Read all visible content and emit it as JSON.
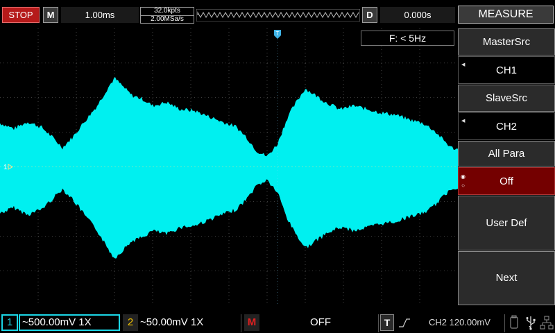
{
  "status": {
    "run_state": "STOP"
  },
  "top": {
    "horizontal_badge": "M",
    "timebase": "1.00ms",
    "memory_depth": "32.0kpts",
    "sample_rate": "2.00MSa/s",
    "delay_badge": "D",
    "delay": "0.000s"
  },
  "menu": {
    "title": "MEASURE",
    "master_src_label": "MasterSrc",
    "master_src_value": "CH1",
    "slave_src_label": "SlaveSrc",
    "slave_src_value": "CH2",
    "all_para_label": "All Para",
    "all_para_value": "Off",
    "user_def_label": "User Def",
    "next_label": "Next"
  },
  "screen": {
    "frequency_readout": "F: < 5Hz",
    "trigger_marker": "T",
    "ch1_marker": "1",
    "waveform_color": "#00f0f0",
    "grid_color": "#7a7a7a"
  },
  "bottom": {
    "ch1_badge": "1",
    "ch1_setting": "~500.00mV  1X",
    "ch2_badge": "2",
    "ch2_setting": "~50.00mV  1X",
    "math_badge": "M",
    "math_state": "OFF",
    "trigger_badge": "T",
    "trigger_info": "CH2 120.00mV"
  },
  "colors": {
    "ch1": "#1bd6e6",
    "ch2": "#f2c200",
    "math": "#e02020",
    "stop": "#b51a1a",
    "selected_menu": "#740000"
  },
  "icons": [
    "rising-edge-icon",
    "usb-drive-icon",
    "usb-icon",
    "network-icon",
    "menu-arrow-icon",
    "radio-icon"
  ]
}
